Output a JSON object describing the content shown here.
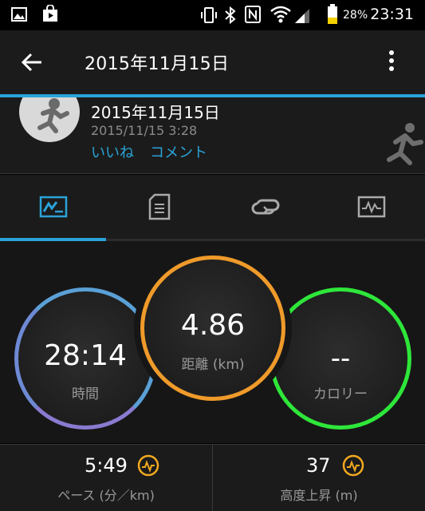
{
  "status_bar": {
    "battery_percent": "28%",
    "time": "23:31",
    "icons": [
      "image-icon",
      "shop-bag-icon",
      "vibrate-icon",
      "bluetooth-icon",
      "nfc-icon",
      "wifi-icon",
      "signal-icon",
      "battery-icon"
    ]
  },
  "app_bar": {
    "title": "2015年11月15日",
    "back_icon": "arrow-back-icon",
    "menu_icon": "more-vertical-icon"
  },
  "activity": {
    "title": "2015年11月15日",
    "datetime": "2015/11/15 3:28",
    "like_label": "いいね",
    "comment_label": "コメント",
    "type_icon": "running-icon"
  },
  "tabs": [
    {
      "icon": "overview-icon",
      "active": true
    },
    {
      "icon": "details-icon",
      "active": false
    },
    {
      "icon": "laps-icon",
      "active": false
    },
    {
      "icon": "charts-icon",
      "active": false
    }
  ],
  "stats": {
    "time": {
      "value": "28:14",
      "label": "時間"
    },
    "distance": {
      "value": "4.86",
      "label": "距離 (km)"
    },
    "calories": {
      "value": "--",
      "label": "カロリー"
    }
  },
  "bottom_stats": {
    "pace": {
      "value": "5:49",
      "label": "ペース (分／km)"
    },
    "elevation": {
      "value": "37",
      "label": "高度上昇 (m)"
    }
  },
  "colors": {
    "accent": "#2aa3d8",
    "time_ring": "#5aa0d6",
    "distance_ring": "#ef9a2a",
    "calories_ring": "#2ee63a",
    "badge": "#f2a91e"
  }
}
